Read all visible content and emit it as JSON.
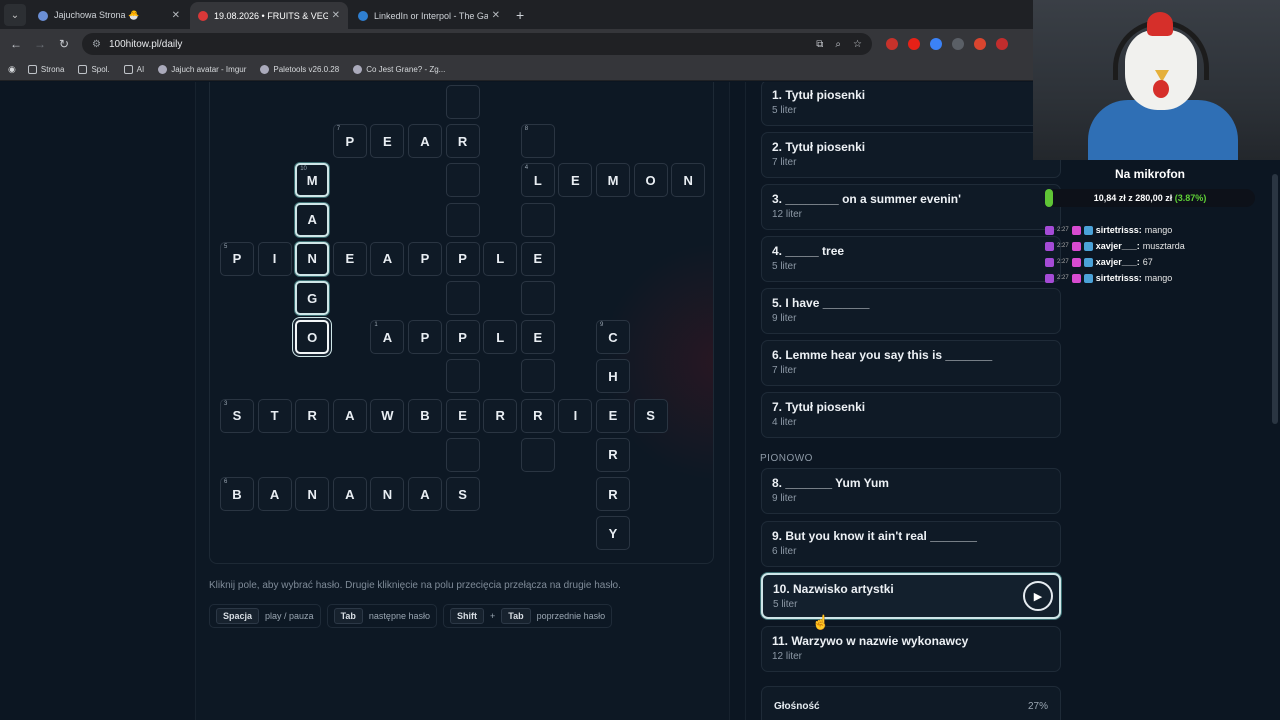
{
  "browser": {
    "tabs": [
      {
        "title": "Jajuchowa Strona 🐣",
        "active": false,
        "color": "#6b8fd6"
      },
      {
        "title": "19.08.2026 • FRUITS & VEGGIES",
        "active": true,
        "color": "#d93838"
      },
      {
        "title": "LinkedIn or Interpol - The Gam",
        "active": false,
        "color": "#2f7fd1"
      }
    ],
    "new_tab": "+",
    "url": "100hitow.pl/daily",
    "bookmarks": [
      "Strona",
      "Spol.",
      "AI",
      "Jajuch avatar - Imgur",
      "Paletools v26.0.28",
      "Co Jest Grane? - Zg..."
    ]
  },
  "crossword": {
    "cells": [
      {
        "r": 0,
        "c": 6,
        "letter": "",
        "num": ""
      },
      {
        "r": 1,
        "c": 3,
        "letter": "P",
        "num": "7"
      },
      {
        "r": 1,
        "c": 4,
        "letter": "E",
        "num": ""
      },
      {
        "r": 1,
        "c": 5,
        "letter": "A",
        "num": ""
      },
      {
        "r": 1,
        "c": 6,
        "letter": "R",
        "num": ""
      },
      {
        "r": 1,
        "c": 8,
        "letter": "",
        "num": "8"
      },
      {
        "r": 2,
        "c": 2,
        "letter": "M",
        "num": "10",
        "state": "hl"
      },
      {
        "r": 2,
        "c": 6,
        "letter": "",
        "num": ""
      },
      {
        "r": 2,
        "c": 8,
        "letter": "L",
        "num": "4"
      },
      {
        "r": 2,
        "c": 9,
        "letter": "E",
        "num": ""
      },
      {
        "r": 2,
        "c": 10,
        "letter": "M",
        "num": ""
      },
      {
        "r": 2,
        "c": 11,
        "letter": "O",
        "num": ""
      },
      {
        "r": 2,
        "c": 12,
        "letter": "N",
        "num": ""
      },
      {
        "r": 3,
        "c": 2,
        "letter": "A",
        "num": "",
        "state": "hl"
      },
      {
        "r": 3,
        "c": 6,
        "letter": "",
        "num": ""
      },
      {
        "r": 3,
        "c": 8,
        "letter": "",
        "num": ""
      },
      {
        "r": 4,
        "c": 0,
        "letter": "P",
        "num": "5"
      },
      {
        "r": 4,
        "c": 1,
        "letter": "I",
        "num": ""
      },
      {
        "r": 4,
        "c": 2,
        "letter": "N",
        "num": "",
        "state": "hl"
      },
      {
        "r": 4,
        "c": 3,
        "letter": "E",
        "num": ""
      },
      {
        "r": 4,
        "c": 4,
        "letter": "A",
        "num": ""
      },
      {
        "r": 4,
        "c": 5,
        "letter": "P",
        "num": ""
      },
      {
        "r": 4,
        "c": 6,
        "letter": "P",
        "num": ""
      },
      {
        "r": 4,
        "c": 7,
        "letter": "L",
        "num": ""
      },
      {
        "r": 4,
        "c": 8,
        "letter": "E",
        "num": ""
      },
      {
        "r": 5,
        "c": 2,
        "letter": "G",
        "num": "",
        "state": "hl"
      },
      {
        "r": 5,
        "c": 6,
        "letter": "",
        "num": ""
      },
      {
        "r": 5,
        "c": 8,
        "letter": "",
        "num": ""
      },
      {
        "r": 6,
        "c": 2,
        "letter": "O",
        "num": "",
        "state": "sel"
      },
      {
        "r": 6,
        "c": 4,
        "letter": "A",
        "num": "1"
      },
      {
        "r": 6,
        "c": 5,
        "letter": "P",
        "num": ""
      },
      {
        "r": 6,
        "c": 6,
        "letter": "P",
        "num": ""
      },
      {
        "r": 6,
        "c": 7,
        "letter": "L",
        "num": ""
      },
      {
        "r": 6,
        "c": 8,
        "letter": "E",
        "num": ""
      },
      {
        "r": 6,
        "c": 10,
        "letter": "C",
        "num": "9"
      },
      {
        "r": 7,
        "c": 6,
        "letter": "",
        "num": ""
      },
      {
        "r": 7,
        "c": 8,
        "letter": "",
        "num": ""
      },
      {
        "r": 7,
        "c": 10,
        "letter": "H",
        "num": ""
      },
      {
        "r": 8,
        "c": 0,
        "letter": "S",
        "num": "3"
      },
      {
        "r": 8,
        "c": 1,
        "letter": "T",
        "num": ""
      },
      {
        "r": 8,
        "c": 2,
        "letter": "R",
        "num": ""
      },
      {
        "r": 8,
        "c": 3,
        "letter": "A",
        "num": ""
      },
      {
        "r": 8,
        "c": 4,
        "letter": "W",
        "num": ""
      },
      {
        "r": 8,
        "c": 5,
        "letter": "B",
        "num": ""
      },
      {
        "r": 8,
        "c": 6,
        "letter": "E",
        "num": ""
      },
      {
        "r": 8,
        "c": 7,
        "letter": "R",
        "num": ""
      },
      {
        "r": 8,
        "c": 8,
        "letter": "R",
        "num": ""
      },
      {
        "r": 8,
        "c": 9,
        "letter": "I",
        "num": ""
      },
      {
        "r": 8,
        "c": 10,
        "letter": "E",
        "num": ""
      },
      {
        "r": 8,
        "c": 11,
        "letter": "S",
        "num": ""
      },
      {
        "r": 9,
        "c": 6,
        "letter": "",
        "num": ""
      },
      {
        "r": 9,
        "c": 8,
        "letter": "",
        "num": ""
      },
      {
        "r": 9,
        "c": 10,
        "letter": "R",
        "num": ""
      },
      {
        "r": 10,
        "c": 0,
        "letter": "B",
        "num": "6"
      },
      {
        "r": 10,
        "c": 1,
        "letter": "A",
        "num": ""
      },
      {
        "r": 10,
        "c": 2,
        "letter": "N",
        "num": ""
      },
      {
        "r": 10,
        "c": 3,
        "letter": "A",
        "num": ""
      },
      {
        "r": 10,
        "c": 4,
        "letter": "N",
        "num": ""
      },
      {
        "r": 10,
        "c": 5,
        "letter": "A",
        "num": ""
      },
      {
        "r": 10,
        "c": 6,
        "letter": "S",
        "num": ""
      },
      {
        "r": 10,
        "c": 10,
        "letter": "R",
        "num": ""
      },
      {
        "r": 11,
        "c": 10,
        "letter": "Y",
        "num": ""
      }
    ],
    "hint": "Kliknij pole, aby wybrać hasło. Drugie kliknięcie na polu przecięcia przełącza na drugie hasło.",
    "shortcuts": [
      {
        "keys": [
          "Spacja"
        ],
        "label": "play / pauza"
      },
      {
        "keys": [
          "Tab"
        ],
        "label": "następne hasło"
      },
      {
        "keys": [
          "Shift",
          "Tab"
        ],
        "label": "poprzednie hasło"
      }
    ],
    "plus": "+"
  },
  "clues": {
    "across": [
      {
        "title": "1. Tytuł piosenki",
        "letters": "5 liter"
      },
      {
        "title": "2. Tytuł piosenki",
        "letters": "7 liter"
      },
      {
        "title": "3. ________ on a summer evenin'",
        "letters": "12 liter"
      },
      {
        "title": "4. _____ tree",
        "letters": "5 liter"
      },
      {
        "title": "5. I have _______",
        "letters": "9 liter"
      },
      {
        "title": "6. Lemme hear you say this is _______",
        "letters": "7 liter"
      },
      {
        "title": "7. Tytuł piosenki",
        "letters": "4 liter"
      }
    ],
    "down_label": "PIONOWO",
    "down": [
      {
        "title": "8. _______ Yum Yum",
        "letters": "9 liter"
      },
      {
        "title": "9. But you know it ain't real _______",
        "letters": "6 liter"
      },
      {
        "title": "10. Nazwisko artystki",
        "letters": "5 liter",
        "active": true
      },
      {
        "title": "11. Warzywo w nazwie wykonawcy",
        "letters": "12 liter"
      }
    ],
    "volume_label": "Głośność",
    "volume_value": "27%"
  },
  "stream": {
    "mic_title": "Na mikrofon",
    "donation_amount": "10,84 zł",
    "donation_sep": "z",
    "donation_goal": "280,00 zł",
    "donation_pct": "(3.87%)",
    "donation_progress": 0.0387,
    "chat": [
      {
        "time": "2:27",
        "user": "sirtetrisss:",
        "msg": "mango"
      },
      {
        "time": "2:27",
        "user": "xavjer___:",
        "msg": "musztarda"
      },
      {
        "time": "2:27",
        "user": "xavjer___:",
        "msg": "67"
      },
      {
        "time": "2:27",
        "user": "sirtetrisss:",
        "msg": "mango"
      }
    ]
  }
}
